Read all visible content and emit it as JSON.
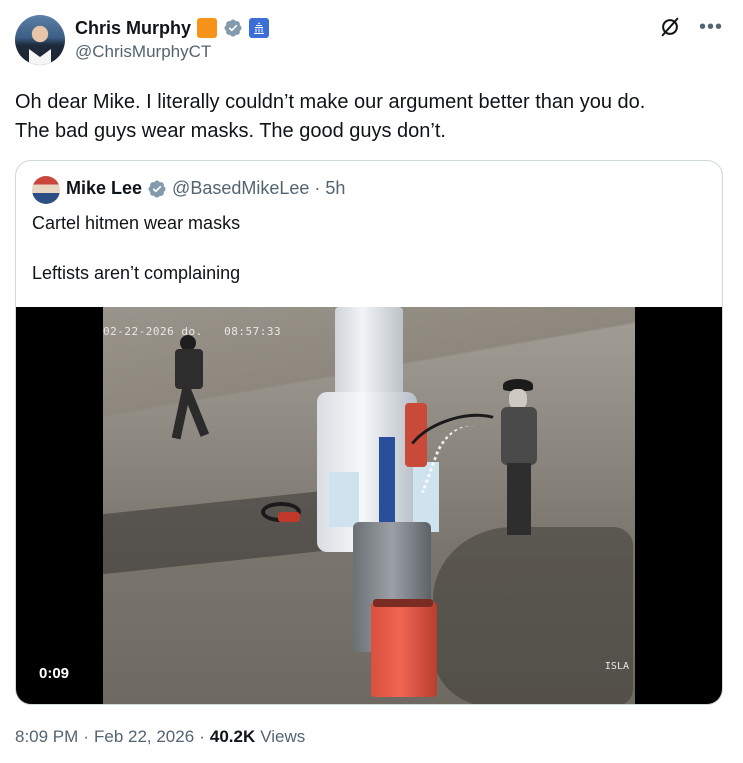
{
  "author": {
    "display_name": "Chris Murphy",
    "handle": "@ChrisMurphyCT",
    "badges": [
      "orange-square-badge",
      "verified-badge-icon",
      "capitol-building-icon"
    ]
  },
  "tweet": {
    "text": "Oh dear Mike. I literally couldn’t make our argument better than you do.\nThe bad guys wear masks. The good guys don’t."
  },
  "quoted": {
    "display_name": "Mike Lee",
    "handle": "@BasedMikeLee",
    "separator": "·",
    "age": "5h",
    "text": "Cartel hitmen wear masks\n\nLeftists aren’t complaining",
    "video": {
      "duration": "0:09",
      "overlay_timestamp": "02-22-2026 do.   08:57:33",
      "camera_label": "ISLA"
    }
  },
  "meta": {
    "time": "8:09 PM",
    "dot1": "·",
    "date": "Feb 22, 2026",
    "dot2": "·",
    "views_count": "40.2K",
    "views_label": "Views"
  },
  "colors": {
    "text_primary": "#0f1419",
    "text_secondary": "#536471",
    "border": "#cfd9de",
    "verified_blue": "#1d9bf0",
    "orange_badge": "#f7931a"
  }
}
